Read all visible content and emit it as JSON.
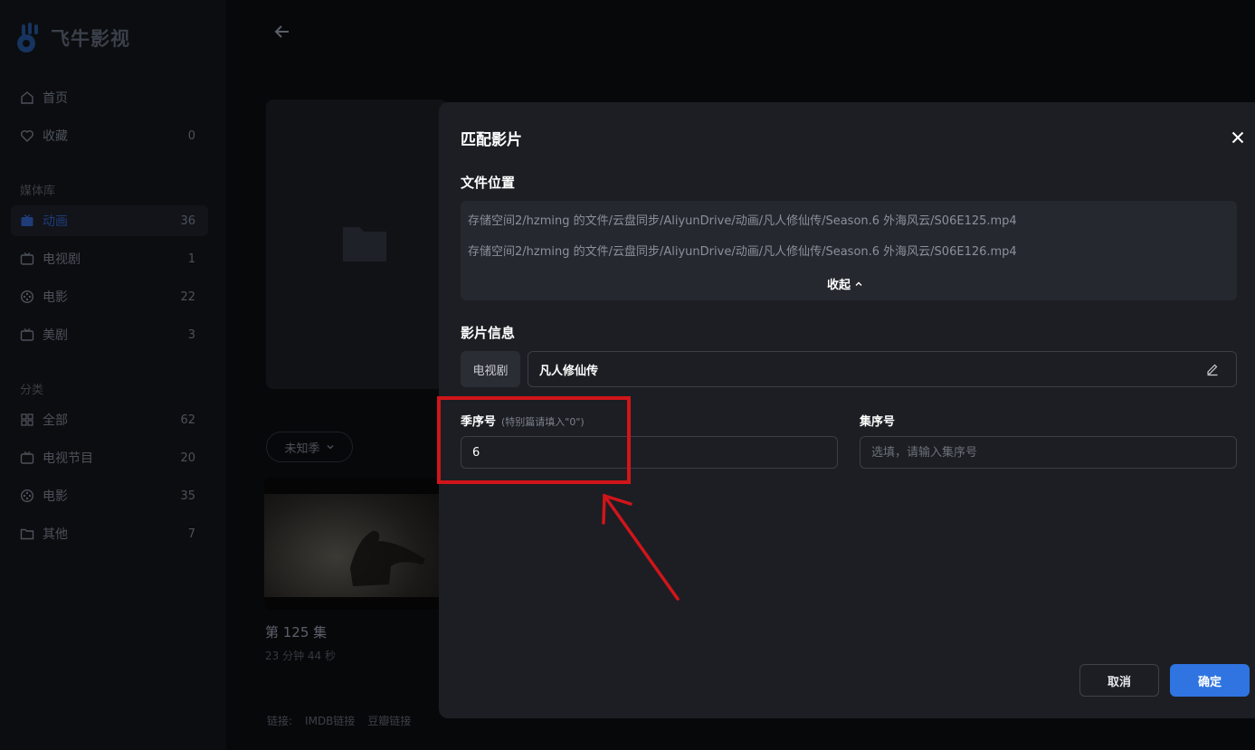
{
  "app": {
    "name": "飞牛影视"
  },
  "sidebar": {
    "top_items": [
      {
        "label": "首页",
        "icon": "home-icon",
        "count": ""
      },
      {
        "label": "收藏",
        "icon": "heart-icon",
        "count": "0"
      }
    ],
    "library_section": "媒体库",
    "library_items": [
      {
        "label": "动画",
        "icon": "tv-icon",
        "count": "36",
        "active": true
      },
      {
        "label": "电视剧",
        "icon": "tv-icon",
        "count": "1"
      },
      {
        "label": "电影",
        "icon": "film-reel-icon",
        "count": "22"
      },
      {
        "label": "美剧",
        "icon": "tv-icon",
        "count": "3"
      }
    ],
    "category_section": "分类",
    "category_items": [
      {
        "label": "全部",
        "icon": "grid-icon",
        "count": "62"
      },
      {
        "label": "电视节目",
        "icon": "tv-icon",
        "count": "20"
      },
      {
        "label": "电影",
        "icon": "film-reel-icon",
        "count": "35"
      },
      {
        "label": "其他",
        "icon": "folder-icon",
        "count": "7"
      }
    ]
  },
  "background": {
    "season_selector": "未知季",
    "episode_title": "第 125 集",
    "episode_duration": "23 分钟 44 秒",
    "links_label": "链接:",
    "link_imdb": "IMDB链接",
    "link_douban": "豆瓣链接"
  },
  "modal": {
    "title": "匹配影片",
    "file_section_title": "文件位置",
    "file_paths": [
      "存储空间2/hzming 的文件/云盘同步/AliyunDrive/动画/凡人修仙传/Season.6 外海风云/S06E125.mp4",
      "存储空间2/hzming 的文件/云盘同步/AliyunDrive/动画/凡人修仙传/Season.6 外海风云/S06E126.mp4"
    ],
    "collapse_label": "收起",
    "info_section_title": "影片信息",
    "media_type": "电视剧",
    "media_title": "凡人修仙传",
    "season_label": "季序号",
    "season_hint": "(特别篇请填入\"0\")",
    "season_value": "6",
    "episode_label": "集序号",
    "episode_placeholder": "选填，请输入集序号",
    "cancel_label": "取消",
    "confirm_label": "确定"
  },
  "colors": {
    "accent": "#2f74e0",
    "annotation": "#d0151a",
    "modal_bg": "#1c1e23"
  }
}
